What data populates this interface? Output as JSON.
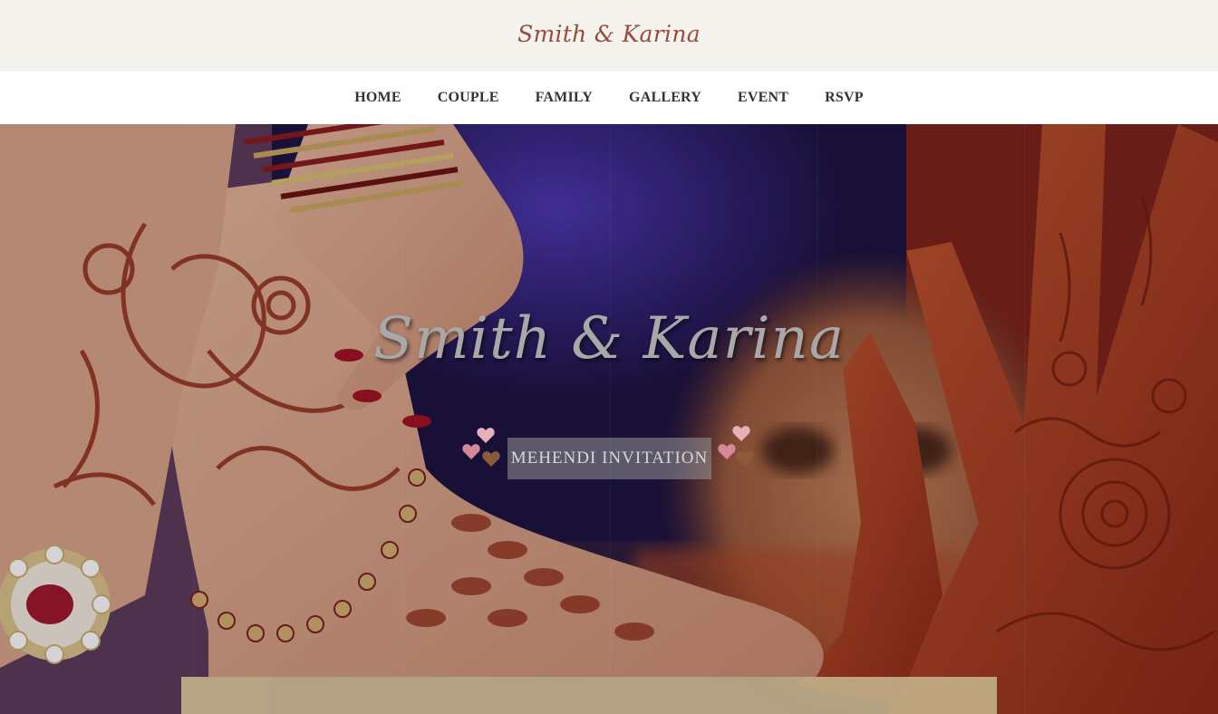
{
  "header": {
    "brand": "Smith & Karina"
  },
  "nav": {
    "items": [
      {
        "label": "HOME",
        "name": "nav-home"
      },
      {
        "label": "COUPLE",
        "name": "nav-couple"
      },
      {
        "label": "FAMILY",
        "name": "nav-family"
      },
      {
        "label": "GALLERY",
        "name": "nav-gallery"
      },
      {
        "label": "EVENT",
        "name": "nav-event"
      },
      {
        "label": "RSVP",
        "name": "nav-rsvp"
      }
    ]
  },
  "hero": {
    "title": "Smith & Karina",
    "subtitle": "MEHENDI INVITATION",
    "decor_icon": "hearts-icon"
  },
  "colors": {
    "topbar_bg": "#f4f3ed",
    "brand": "#9a4a3e",
    "nav_text": "#333333",
    "henna": "#8e2a14",
    "backdrop_purple": "#3b2a8a"
  }
}
